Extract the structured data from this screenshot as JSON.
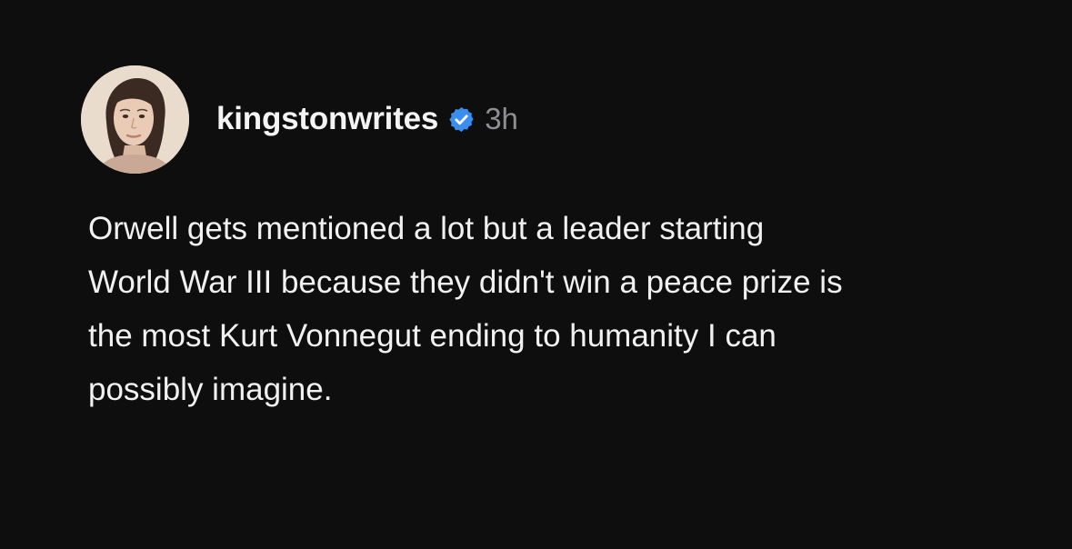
{
  "post": {
    "author": {
      "username": "kingstonwrites",
      "verified": true,
      "verified_badge_color": "#3b8ef0",
      "avatar_icon": "profile-photo"
    },
    "timestamp": "3h",
    "body_lines": [
      "Orwell gets mentioned a lot but a leader starting",
      "World War III because they didn't win a peace prize is",
      "the most Kurt Vonnegut ending to humanity I can",
      "possibly imagine."
    ]
  },
  "theme": {
    "background": "#0e0e0f",
    "text": "#f1f1f1",
    "muted_text": "#8e8e93"
  }
}
